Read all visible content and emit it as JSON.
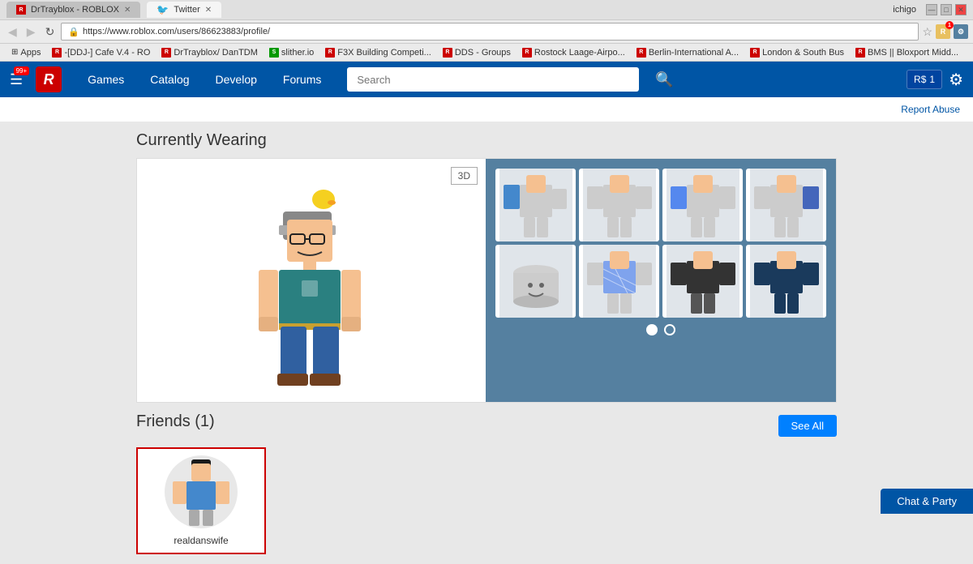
{
  "browser": {
    "title_inactive_tab": "DrTrayblox - ROBLOX",
    "title_active_tab": "Twitter",
    "url": "https://www.roblox.com/users/86623883/profile/",
    "user": "ichigo",
    "window_controls": [
      "minimize",
      "maximize",
      "close"
    ]
  },
  "bookmarks": [
    {
      "label": "Apps",
      "icon": "A"
    },
    {
      "label": "R -[DDJ-] Cafe V.4 - RO",
      "icon": "R"
    },
    {
      "label": "DrTrayblox/ DanTDM",
      "icon": "R"
    },
    {
      "label": "slither.io",
      "icon": "S"
    },
    {
      "label": "F3X Building Competi...",
      "icon": "R"
    },
    {
      "label": "DDS - Groups",
      "icon": "R"
    },
    {
      "label": "Rostock Laage-Airpo...",
      "icon": "R"
    },
    {
      "label": "Berlin-International A...",
      "icon": "R"
    },
    {
      "label": "London & South Bus",
      "icon": "R"
    },
    {
      "label": "BMS || Bloxport Midd...",
      "icon": "R"
    }
  ],
  "roblox_nav": {
    "notification_count": "99+",
    "links": [
      "Games",
      "Catalog",
      "Develop",
      "Forums"
    ],
    "search_placeholder": "Search",
    "rs_count": "1"
  },
  "page": {
    "report_link": "Report Abuse",
    "currently_wearing_title": "Currently Wearing",
    "btn_3d": "3D",
    "dot_count": 2,
    "friends_title": "Friends (1)",
    "see_all_label": "See All",
    "friend": {
      "name": "realdanswife"
    },
    "chat_btn": "Chat & Party"
  },
  "items": [
    {
      "id": 1,
      "has_blue": true
    },
    {
      "id": 2,
      "has_blue": false
    },
    {
      "id": 3,
      "has_blue": true
    },
    {
      "id": 4,
      "has_blue": false
    },
    {
      "id": 5,
      "has_gray": true
    },
    {
      "id": 6,
      "has_blue": true
    },
    {
      "id": 7,
      "has_dark": true
    },
    {
      "id": 8,
      "has_dark": true
    }
  ]
}
